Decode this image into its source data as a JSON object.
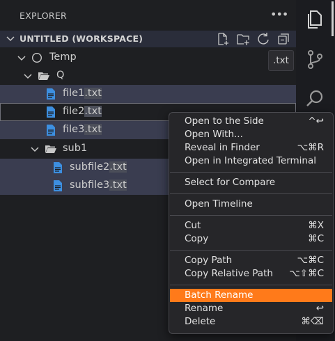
{
  "explorer": {
    "title": "EXPLORER",
    "more_icon": "ellipsis-icon",
    "workspace_title": "UNTITLED (WORKSPACE)",
    "toolbar_icons": [
      "new-file-icon",
      "new-folder-icon",
      "refresh-icon",
      "collapse-all-icon"
    ]
  },
  "tree": {
    "root": "Temp",
    "q_folder": "Q",
    "file1": {
      "name": "file1",
      "ext": ".txt"
    },
    "file2": {
      "name": "file2",
      "ext": ".txt"
    },
    "file3": {
      "name": "file3",
      "ext": ".txt"
    },
    "sub_folder": "sub1",
    "subfile2": {
      "name": "subfile2",
      "ext": ".txt"
    },
    "subfile3": {
      "name": "subfile3",
      "ext": ".txt"
    }
  },
  "tooltip": ".txt",
  "activity_bar": [
    "explorer-icon",
    "source-control-icon",
    "search-icon"
  ],
  "menu": {
    "open_side": {
      "label": "Open to the Side",
      "key": "^↩"
    },
    "open_with": {
      "label": "Open With..."
    },
    "reveal": {
      "label": "Reveal in Finder",
      "key": "⌥⌘R"
    },
    "open_terminal": {
      "label": "Open in Integrated Terminal"
    },
    "compare": {
      "label": "Select for Compare"
    },
    "timeline": {
      "label": "Open Timeline"
    },
    "cut": {
      "label": "Cut",
      "key": "⌘X"
    },
    "copy": {
      "label": "Copy",
      "key": "⌘C"
    },
    "copy_path": {
      "label": "Copy Path",
      "key": "⌥⌘C"
    },
    "copy_rel_path": {
      "label": "Copy Relative Path",
      "key": "⌥⇧⌘C"
    },
    "batch_rename": {
      "label": "Batch Rename"
    },
    "rename": {
      "label": "Rename",
      "key": "↩"
    },
    "delete": {
      "label": "Delete",
      "key": "⌘⌫"
    }
  },
  "colors": {
    "menu_highlight": "#ff7a1a",
    "file_icon": "#3d8fe0",
    "selection": "#3a3d50"
  }
}
